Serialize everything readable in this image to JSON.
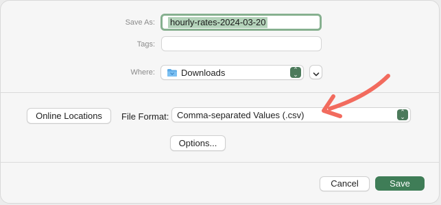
{
  "save_as": {
    "label": "Save As:",
    "value": "hourly-rates-2024-03-20"
  },
  "tags": {
    "label": "Tags:",
    "value": ""
  },
  "where": {
    "label": "Where:",
    "value": "Downloads",
    "icon": "folder-icon"
  },
  "buttons": {
    "online_locations": "Online Locations",
    "options": "Options...",
    "cancel": "Cancel",
    "save": "Save"
  },
  "file_format": {
    "label": "File Format:",
    "value": "Comma-separated Values (.csv)"
  },
  "colors": {
    "accent": "#3f7d57",
    "arrow": "#f26b5e",
    "focus_ring": "#86b08f"
  }
}
